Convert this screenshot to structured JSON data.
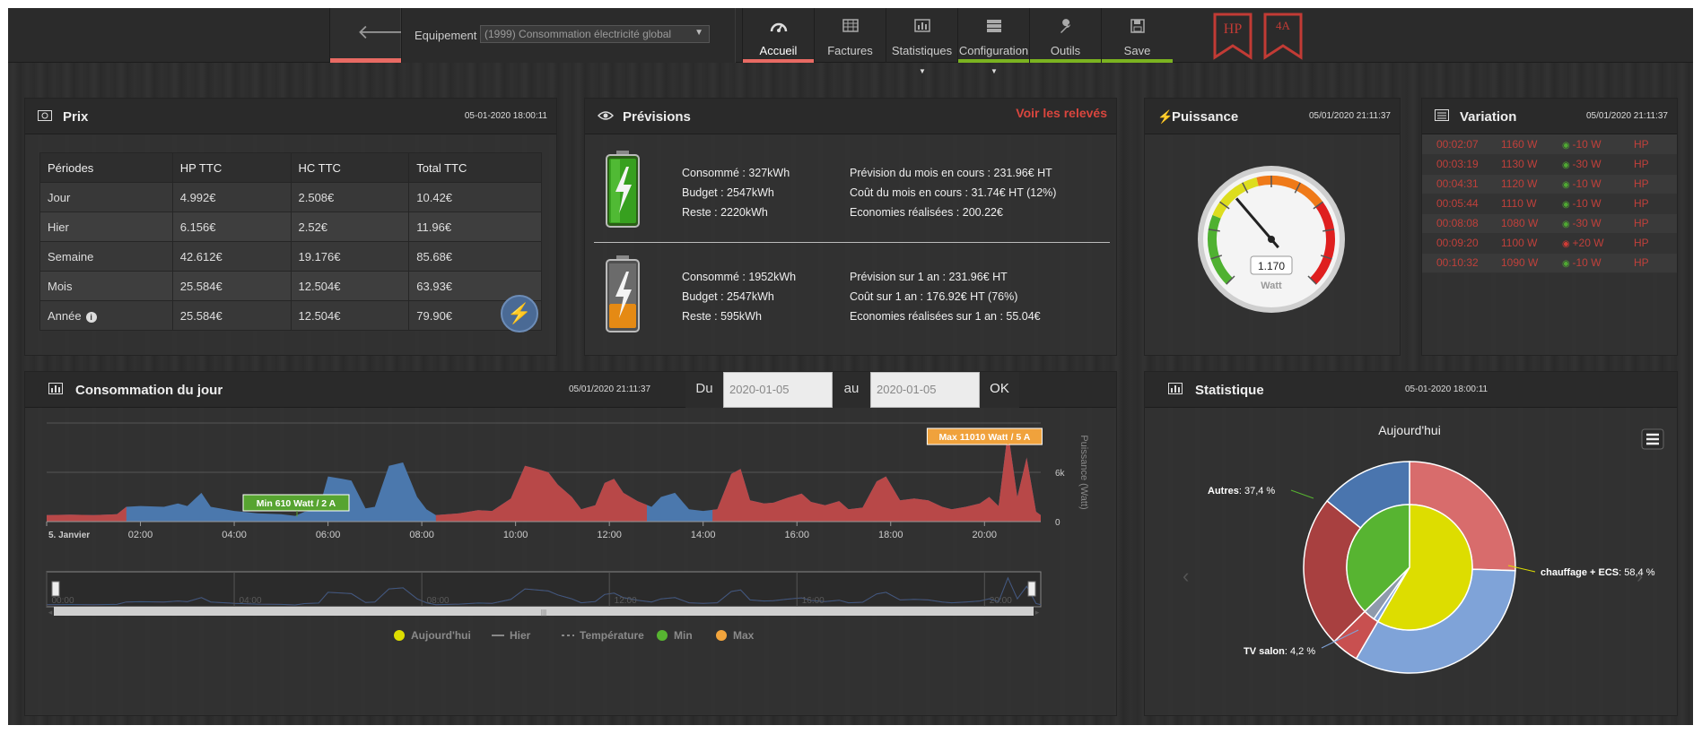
{
  "nav": {
    "equipement_label": "Equipement :",
    "equipement_value": "(1999) Consommation électricité global",
    "tabs": [
      {
        "label": "Accueil",
        "icon": "dashboard-icon",
        "active": true,
        "underline": "#e86a63"
      },
      {
        "label": "Factures",
        "icon": "table-icon",
        "active": false,
        "underline": ""
      },
      {
        "label": "Statistiques",
        "icon": "bar-chart-icon",
        "active": false,
        "underline": ""
      },
      {
        "label": "Configuration",
        "icon": "server-icon",
        "active": false,
        "underline": "#7bb320"
      },
      {
        "label": "Outils",
        "icon": "wrench-icon",
        "active": false,
        "underline": "#7bb320"
      },
      {
        "label": "Save",
        "icon": "floppy-icon",
        "active": false,
        "underline": "#7bb320"
      }
    ],
    "badges": [
      "HP",
      "4A"
    ]
  },
  "prix": {
    "title": "Prix",
    "date": "05-01-2020 18:00:11",
    "headers": [
      "Périodes",
      "HP TTC",
      "HC TTC",
      "Total TTC"
    ],
    "rows": [
      [
        "Jour",
        "4.992€",
        "2.508€",
        "10.42€"
      ],
      [
        "Hier",
        "6.156€",
        "2.52€",
        "11.96€"
      ],
      [
        "Semaine",
        "42.612€",
        "19.176€",
        "85.68€"
      ],
      [
        "Mois",
        "25.584€",
        "12.504€",
        "63.93€"
      ],
      [
        "Année",
        "25.584€",
        "12.504€",
        "79.90€"
      ]
    ]
  },
  "previsions": {
    "title": "Prévisions",
    "link": "Voir les relevés",
    "month": {
      "col1": [
        "Consommé : 327kWh",
        "Budget : 2547kWh",
        "Reste : 2220kWh"
      ],
      "col2": [
        "Prévision du mois en cours : 231.96€ HT",
        "Coût du mois en cours : 31.74€ HT (12%)",
        "Economies réalisées : 200.22€"
      ]
    },
    "year": {
      "col1": [
        "Consommé : 1952kWh",
        "Budget : 2547kWh",
        "Reste : 595kWh"
      ],
      "col2": [
        "Prévision sur 1 an : 231.96€ HT",
        "Coût sur 1 an : 176.92€ HT (76%)",
        "Economies réalisées sur 1 an : 55.04€"
      ]
    }
  },
  "puissance": {
    "title": "Puissance",
    "date": "05/01/2020 21:11:37",
    "value": "1.170",
    "unit": "Watt",
    "level": 0.35
  },
  "variation": {
    "title": "Variation",
    "date": "05/01/2020 21:11:37",
    "rows": [
      {
        "time": "00:02:07",
        "power": "1160 W",
        "delta": "-10 W",
        "up": false,
        "tarif": "HP"
      },
      {
        "time": "00:03:19",
        "power": "1130 W",
        "delta": "-30 W",
        "up": false,
        "tarif": "HP"
      },
      {
        "time": "00:04:31",
        "power": "1120 W",
        "delta": "-10 W",
        "up": false,
        "tarif": "HP"
      },
      {
        "time": "00:05:44",
        "power": "1110 W",
        "delta": "-10 W",
        "up": false,
        "tarif": "HP"
      },
      {
        "time": "00:08:08",
        "power": "1080 W",
        "delta": "-30 W",
        "up": false,
        "tarif": "HP"
      },
      {
        "time": "00:09:20",
        "power": "1100 W",
        "delta": "+20 W",
        "up": true,
        "tarif": "HP"
      },
      {
        "time": "00:10:32",
        "power": "1090 W",
        "delta": "-10 W",
        "up": false,
        "tarif": "HP"
      }
    ]
  },
  "conso": {
    "title": "Consommation du jour",
    "date": "05/01/2020 21:11:37",
    "du_label": "Du",
    "du_value": "2020-01-05",
    "au_label": "au",
    "au_value": "2020-01-05",
    "ok_label": "OK",
    "min_label": "Min 610 Watt / 2 A",
    "max_label": "Max 11010 Watt / 5 A",
    "yaxis_title": "Puissance (Watt)",
    "legend": [
      {
        "label": "Aujourd'hui",
        "color": "#dddd00",
        "kind": "dot"
      },
      {
        "label": "Hier",
        "color": "#888888",
        "kind": "line"
      },
      {
        "label": "Température",
        "color": "#888888",
        "kind": "dash"
      },
      {
        "label": "Min",
        "color": "#57b431",
        "kind": "dot"
      },
      {
        "label": "Max",
        "color": "#f2a43c",
        "kind": "dot"
      }
    ]
  },
  "statistique": {
    "title": "Statistique",
    "date": "05-01-2020 18:00:11"
  },
  "chart_data": [
    {
      "type": "area",
      "title": "",
      "xlabel": "",
      "ylabel": "Puissance (Watt)",
      "xticks": [
        "5. Janvier",
        "02:00",
        "04:00",
        "06:00",
        "08:00",
        "10:00",
        "12:00",
        "14:00",
        "16:00",
        "18:00",
        "20:00"
      ],
      "yticks": [
        "0",
        "6k"
      ],
      "xlim_hours": [
        0,
        21.2
      ],
      "ylim": [
        0,
        12000
      ],
      "navigator_ticks": [
        "00:00",
        "04:00",
        "08:00",
        "12:00",
        "16:00",
        "20:00"
      ],
      "series": [
        {
          "color_hp": "#b84848",
          "color_hc": "#4b78ad",
          "hp_periods_hours": [
            [
              0,
              1.7
            ],
            [
              8.3,
              12.8
            ],
            [
              14.2,
              21.2
            ]
          ],
          "points": [
            [
              0,
              800
            ],
            [
              0.5,
              850
            ],
            [
              1.0,
              800
            ],
            [
              1.5,
              900
            ],
            [
              1.7,
              1800
            ],
            [
              2.0,
              1900
            ],
            [
              2.5,
              1800
            ],
            [
              2.8,
              2200
            ],
            [
              3.0,
              1900
            ],
            [
              3.3,
              3500
            ],
            [
              3.5,
              1800
            ],
            [
              4.0,
              1300
            ],
            [
              4.5,
              1000
            ],
            [
              5.0,
              900
            ],
            [
              5.3,
              700
            ],
            [
              5.5,
              1200
            ],
            [
              5.8,
              1400
            ],
            [
              6.0,
              5500
            ],
            [
              6.3,
              5200
            ],
            [
              6.5,
              5000
            ],
            [
              6.8,
              1600
            ],
            [
              7.0,
              1800
            ],
            [
              7.3,
              6800
            ],
            [
              7.6,
              7200
            ],
            [
              7.9,
              3000
            ],
            [
              8.1,
              1500
            ],
            [
              8.3,
              800
            ],
            [
              8.8,
              1000
            ],
            [
              9.2,
              1400
            ],
            [
              9.5,
              1300
            ],
            [
              9.9,
              2800
            ],
            [
              10.2,
              6800
            ],
            [
              10.4,
              6500
            ],
            [
              10.7,
              6000
            ],
            [
              10.9,
              4500
            ],
            [
              11.2,
              3000
            ],
            [
              11.4,
              1500
            ],
            [
              11.7,
              2000
            ],
            [
              11.9,
              4700
            ],
            [
              12.1,
              5200
            ],
            [
              12.3,
              3500
            ],
            [
              12.6,
              2500
            ],
            [
              12.9,
              1800
            ],
            [
              13.1,
              3000
            ],
            [
              13.4,
              3500
            ],
            [
              13.7,
              1500
            ],
            [
              14.0,
              1300
            ],
            [
              14.3,
              1500
            ],
            [
              14.6,
              5800
            ],
            [
              14.8,
              6400
            ],
            [
              15.0,
              2600
            ],
            [
              15.3,
              2200
            ],
            [
              15.5,
              2300
            ],
            [
              15.8,
              2900
            ],
            [
              16.1,
              3400
            ],
            [
              16.3,
              2400
            ],
            [
              16.6,
              2000
            ],
            [
              16.9,
              2500
            ],
            [
              17.1,
              1500
            ],
            [
              17.4,
              1700
            ],
            [
              17.7,
              4900
            ],
            [
              17.9,
              5500
            ],
            [
              18.2,
              2600
            ],
            [
              18.5,
              2800
            ],
            [
              18.8,
              2600
            ],
            [
              19.1,
              1800
            ],
            [
              19.3,
              1500
            ],
            [
              19.6,
              1800
            ],
            [
              19.9,
              2200
            ],
            [
              20.1,
              3000
            ],
            [
              20.3,
              1900
            ],
            [
              20.5,
              11010
            ],
            [
              20.7,
              3000
            ],
            [
              20.9,
              7800
            ],
            [
              21.1,
              1200
            ],
            [
              21.2,
              800
            ]
          ]
        }
      ],
      "annotations": [
        {
          "text": "Min 610 Watt / 2 A",
          "x_hours": 5.3,
          "y": 610
        },
        {
          "text": "Max 11010 Watt / 5 A",
          "x_hours": 20.5,
          "y": 11010
        }
      ]
    },
    {
      "type": "pie",
      "title": "Aujourd'hui",
      "inner": [
        {
          "name": "",
          "value": 58.4,
          "color": "#dddd00"
        },
        {
          "name": "",
          "value": 1.2,
          "color": "#7fa3d8"
        },
        {
          "name": "",
          "value": 3.0,
          "color": "#8e9aac"
        },
        {
          "name": "",
          "value": 37.4,
          "color": "#57b431"
        }
      ],
      "outer": [
        {
          "name": "",
          "value": 25.5,
          "color": "#d86c6c"
        },
        {
          "name": "",
          "value": 32.9,
          "color": "#7fa3d8"
        },
        {
          "name": "",
          "value": 4.2,
          "color": "#c85050"
        },
        {
          "name": "",
          "value": 23.2,
          "color": "#a84040"
        },
        {
          "name": "",
          "value": 14.2,
          "color": "#4a75ae"
        }
      ],
      "labels": [
        {
          "name": "chauffage + ECS",
          "pct": "58,4 %"
        },
        {
          "name": "Autres",
          "pct": "37,4 %"
        },
        {
          "name": "TV salon",
          "pct": "4,2 %"
        }
      ]
    }
  ]
}
